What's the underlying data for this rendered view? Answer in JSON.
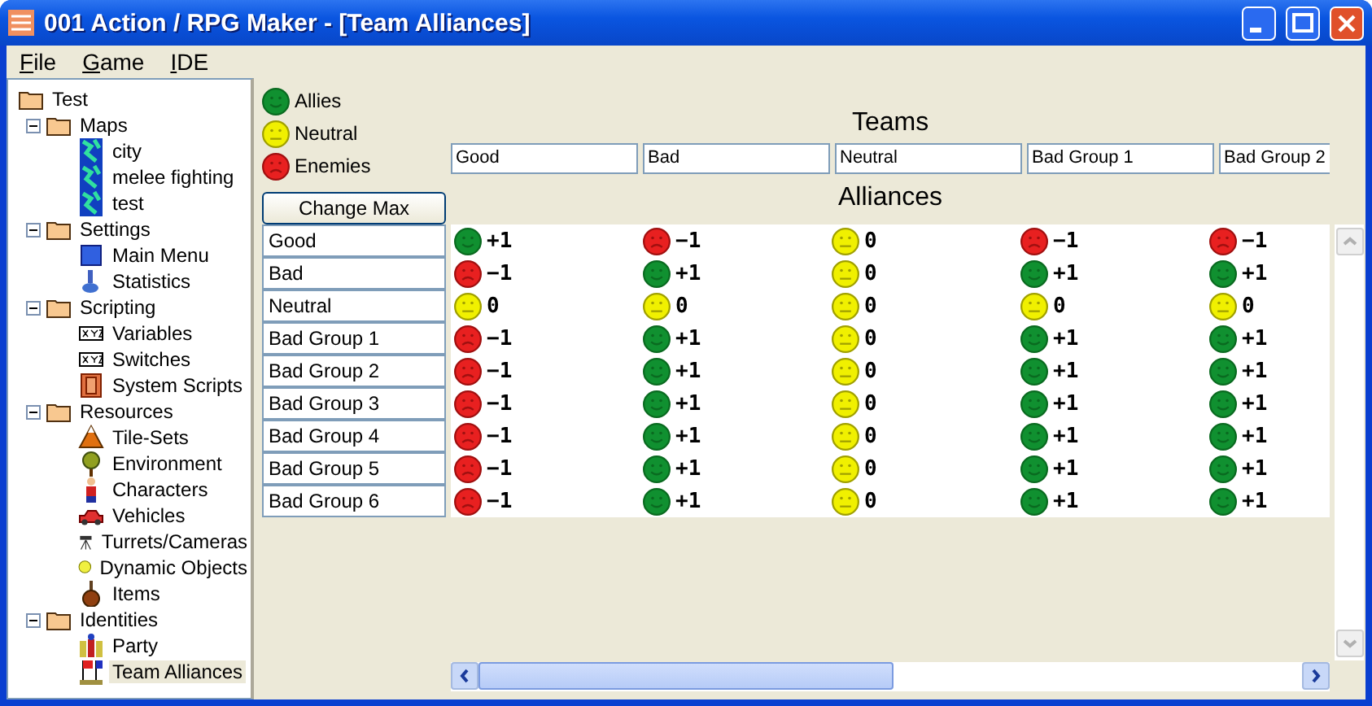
{
  "window": {
    "title": "001 Action / RPG Maker - [Team Alliances]"
  },
  "menu": [
    "File",
    "Game",
    "IDE"
  ],
  "tree": {
    "label": "Test",
    "kind": "folder",
    "children": [
      {
        "label": "Maps",
        "kind": "folder",
        "expanded": true,
        "children": [
          {
            "label": "city",
            "kind": "map",
            "selected": false
          },
          {
            "label": "melee fighting",
            "kind": "map",
            "selected": false
          },
          {
            "label": "test",
            "kind": "map",
            "selected": false
          }
        ]
      },
      {
        "label": "Settings",
        "kind": "folder",
        "expanded": true,
        "children": [
          {
            "label": "Main Menu",
            "kind": "square",
            "selected": false
          },
          {
            "label": "Statistics",
            "kind": "flask",
            "selected": false
          }
        ]
      },
      {
        "label": "Scripting",
        "kind": "folder",
        "expanded": true,
        "children": [
          {
            "label": "Variables",
            "kind": "xyz",
            "selected": false
          },
          {
            "label": "Switches",
            "kind": "xyz",
            "selected": false
          },
          {
            "label": "System Scripts",
            "kind": "scroll",
            "selected": false
          }
        ]
      },
      {
        "label": "Resources",
        "kind": "folder",
        "expanded": true,
        "children": [
          {
            "label": "Tile-Sets",
            "kind": "mountain",
            "selected": false
          },
          {
            "label": "Environment",
            "kind": "tree",
            "selected": false
          },
          {
            "label": "Characters",
            "kind": "person",
            "selected": false
          },
          {
            "label": "Vehicles",
            "kind": "car",
            "selected": false
          },
          {
            "label": "Turrets/Cameras",
            "kind": "tripod",
            "selected": false
          },
          {
            "label": "Dynamic Objects",
            "kind": "bulb",
            "selected": false
          },
          {
            "label": "Items",
            "kind": "bag",
            "selected": false
          }
        ]
      },
      {
        "label": "Identities",
        "kind": "folder",
        "expanded": true,
        "children": [
          {
            "label": "Party",
            "kind": "party",
            "selected": false
          },
          {
            "label": "Team Alliances",
            "kind": "flags",
            "selected": true
          }
        ]
      }
    ]
  },
  "legend": [
    {
      "label": "Allies",
      "kind": "ally"
    },
    {
      "label": "Neutral",
      "kind": "neutral"
    },
    {
      "label": "Enemies",
      "kind": "enemy"
    }
  ],
  "teams_heading": "Teams",
  "teams": [
    "Good",
    "Bad",
    "Neutral",
    "Bad Group 1",
    "Bad Group 2"
  ],
  "change_max_button": "Change Max",
  "alliances_heading": "Alliances",
  "rows": [
    {
      "label": "Good",
      "cells": [
        {
          "kind": "ally",
          "value": "+1"
        },
        {
          "kind": "enemy",
          "value": "−1"
        },
        {
          "kind": "neutral",
          "value": "0"
        },
        {
          "kind": "enemy",
          "value": "−1"
        },
        {
          "kind": "enemy",
          "value": "−1"
        }
      ]
    },
    {
      "label": "Bad",
      "cells": [
        {
          "kind": "enemy",
          "value": "−1"
        },
        {
          "kind": "ally",
          "value": "+1"
        },
        {
          "kind": "neutral",
          "value": "0"
        },
        {
          "kind": "ally",
          "value": "+1"
        },
        {
          "kind": "ally",
          "value": "+1"
        }
      ]
    },
    {
      "label": "Neutral",
      "cells": [
        {
          "kind": "neutral",
          "value": "0"
        },
        {
          "kind": "neutral",
          "value": "0"
        },
        {
          "kind": "neutral",
          "value": "0"
        },
        {
          "kind": "neutral",
          "value": "0"
        },
        {
          "kind": "neutral",
          "value": "0"
        }
      ]
    },
    {
      "label": "Bad Group 1",
      "cells": [
        {
          "kind": "enemy",
          "value": "−1"
        },
        {
          "kind": "ally",
          "value": "+1"
        },
        {
          "kind": "neutral",
          "value": "0"
        },
        {
          "kind": "ally",
          "value": "+1"
        },
        {
          "kind": "ally",
          "value": "+1"
        }
      ]
    },
    {
      "label": "Bad Group 2",
      "cells": [
        {
          "kind": "enemy",
          "value": "−1"
        },
        {
          "kind": "ally",
          "value": "+1"
        },
        {
          "kind": "neutral",
          "value": "0"
        },
        {
          "kind": "ally",
          "value": "+1"
        },
        {
          "kind": "ally",
          "value": "+1"
        }
      ]
    },
    {
      "label": "Bad Group 3",
      "cells": [
        {
          "kind": "enemy",
          "value": "−1"
        },
        {
          "kind": "ally",
          "value": "+1"
        },
        {
          "kind": "neutral",
          "value": "0"
        },
        {
          "kind": "ally",
          "value": "+1"
        },
        {
          "kind": "ally",
          "value": "+1"
        }
      ]
    },
    {
      "label": "Bad Group 4",
      "cells": [
        {
          "kind": "enemy",
          "value": "−1"
        },
        {
          "kind": "ally",
          "value": "+1"
        },
        {
          "kind": "neutral",
          "value": "0"
        },
        {
          "kind": "ally",
          "value": "+1"
        },
        {
          "kind": "ally",
          "value": "+1"
        }
      ]
    },
    {
      "label": "Bad Group 5",
      "cells": [
        {
          "kind": "enemy",
          "value": "−1"
        },
        {
          "kind": "ally",
          "value": "+1"
        },
        {
          "kind": "neutral",
          "value": "0"
        },
        {
          "kind": "ally",
          "value": "+1"
        },
        {
          "kind": "ally",
          "value": "+1"
        }
      ]
    },
    {
      "label": "Bad Group 6",
      "cells": [
        {
          "kind": "enemy",
          "value": "−1"
        },
        {
          "kind": "ally",
          "value": "+1"
        },
        {
          "kind": "neutral",
          "value": "0"
        },
        {
          "kind": "ally",
          "value": "+1"
        },
        {
          "kind": "ally",
          "value": "+1"
        }
      ]
    }
  ]
}
